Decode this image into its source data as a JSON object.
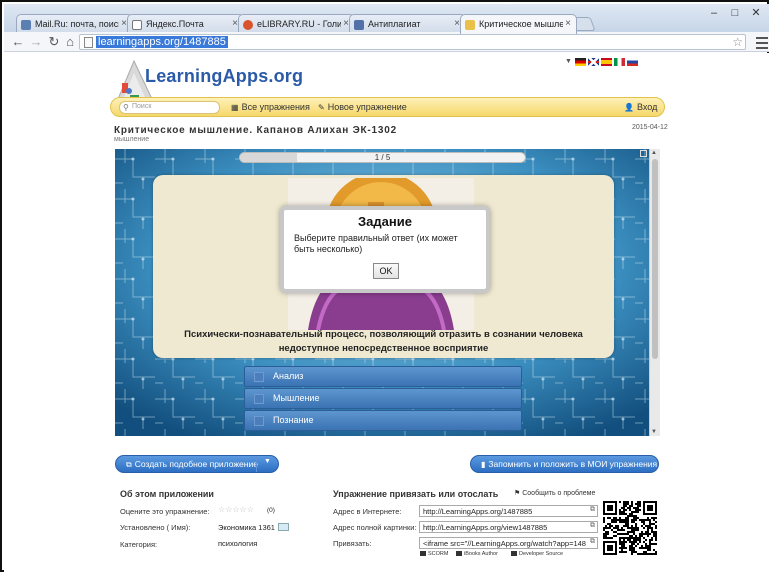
{
  "browser": {
    "tabs": [
      {
        "title": "Mail.Ru: почта, поиск в и",
        "favicon_color": "#5b7fb3"
      },
      {
        "title": "Яндекс.Почта",
        "favicon_color": "#cccccc"
      },
      {
        "title": "eLIBRARY.RU - Голицынск",
        "favicon_color": "#d9532c"
      },
      {
        "title": "Антиплагиат",
        "favicon_color": "#5470a8"
      },
      {
        "title": "Критическое мышление",
        "favicon_color": "#e8c04a"
      }
    ],
    "url": "learningapps.org/1487885"
  },
  "site": {
    "logo_text": "LearningApps.org",
    "search_placeholder": "Поиск",
    "nav": {
      "all_exercises": "Все упражнения",
      "new_exercise": "Новое упражнение",
      "login": "Вход"
    }
  },
  "app": {
    "title": "Критическое мышление. Капанов Алихан ЭК-1302",
    "subtitle": "мышление",
    "date": "2015-04-12",
    "progress": {
      "label": "1 / 5",
      "fraction": 0.2
    },
    "question": "Психически-познавательный процесс, позволяющий отразить в сознании человека недоступное непосредственное восприятие",
    "answers": [
      "Анализ",
      "Мышление",
      "Познание"
    ],
    "dialog": {
      "title": "Задание",
      "body": "Выберите правильный ответ (их может быть несколько)",
      "ok": "OK"
    }
  },
  "actions": {
    "create_similar": "Создать подобное приложение",
    "save": "Запомнить и положить в МОИ упражнения"
  },
  "about": {
    "title": "Об этом приложении",
    "rate_label": "Оцените это упражнение:",
    "rate_count": "(0)",
    "installed_label": "Установлено ( Имя):",
    "installed_value": "Экономика 1361",
    "category_label": "Категория:",
    "category_value": "психология"
  },
  "share": {
    "title": "Упражнение привязать или отослать",
    "report": "Сообщить о проблеме",
    "internet_label": "Адрес в Интернете:",
    "internet_value": "http://LearningApps.org/1487885",
    "fullscreen_label": "Адрес полной картинки:",
    "fullscreen_value": "http://LearningApps.org/view1487885",
    "embed_label": "Привязать:",
    "embed_value": "<iframe src=\"//LearningApps.org/watch?app=148",
    "formats": [
      "SCORM",
      "iBooks Author",
      "Developer Source"
    ]
  }
}
